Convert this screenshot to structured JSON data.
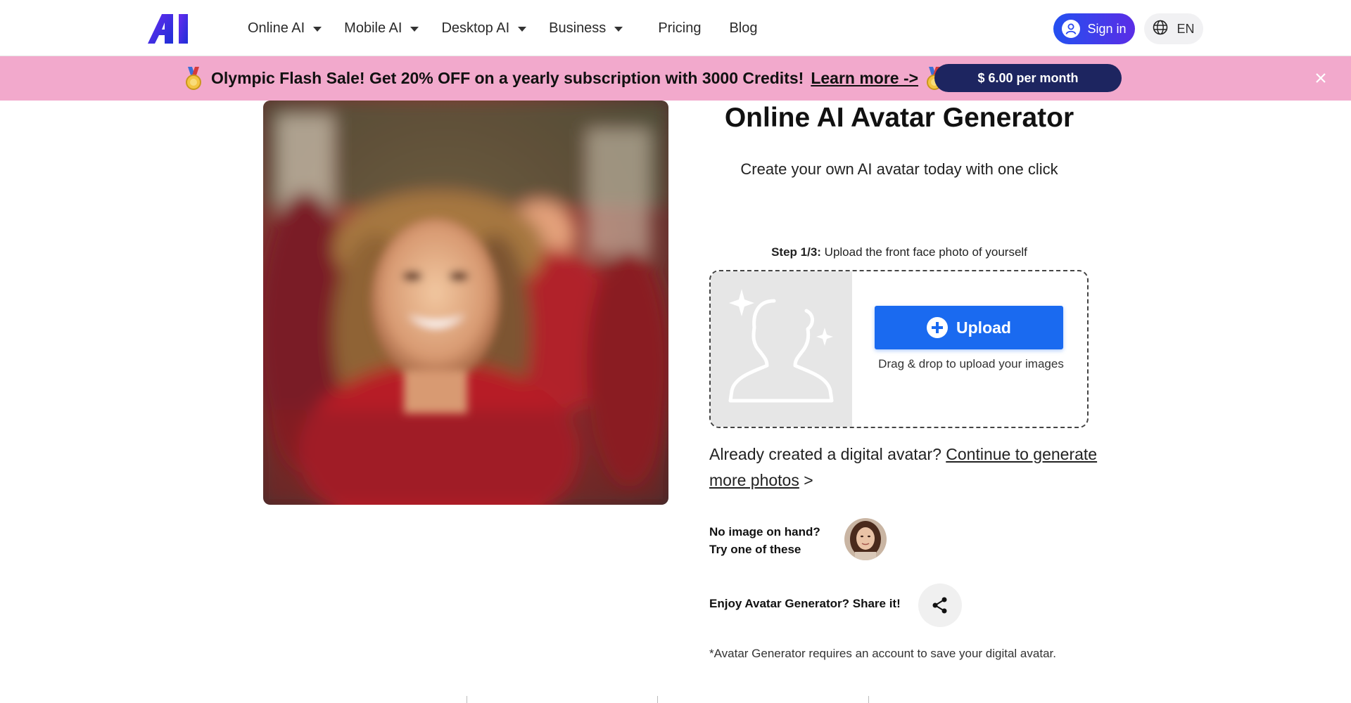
{
  "nav": {
    "logo_icon": "ai-logo-icon",
    "items": [
      {
        "label": "Online AI",
        "dropdown": true
      },
      {
        "label": "Mobile AI",
        "dropdown": true
      },
      {
        "label": "Desktop AI",
        "dropdown": true
      },
      {
        "label": "Business",
        "dropdown": true
      },
      {
        "label": "Pricing",
        "dropdown": false
      },
      {
        "label": "Blog",
        "dropdown": false
      }
    ],
    "signin_label": "Sign in",
    "lang_label": "EN"
  },
  "promo": {
    "text": "Olympic Flash Sale! Get 20% OFF on a yearly subscription with 3000 Credits!",
    "link": "Learn more ->",
    "price_button": "$ 6.00 per month",
    "background": "#f2a9cc"
  },
  "main": {
    "title": "Online AI Avatar Generator",
    "subtitle": "Create your own AI avatar today with one click",
    "step_bold": "Step 1/3:",
    "step_text": " Upload the front face photo of yourself",
    "upload_label": "Upload",
    "drag_text": "Drag & drop to upload your images",
    "already_text": "Already created a digital avatar? ",
    "continue_link": "Continue to generate more photos",
    "continue_arrow": " >",
    "no_image_line1": "No image on hand?",
    "no_image_line2": "Try one of these",
    "share_label": "Enjoy Avatar Generator? Share it!",
    "note": "*Avatar Generator requires an account to save your digital avatar."
  },
  "colors": {
    "accent": "#1a6af0",
    "signin_gradient_start": "#2450f0",
    "signin_gradient_end": "#5a2de6",
    "price_button": "#1d2560"
  }
}
